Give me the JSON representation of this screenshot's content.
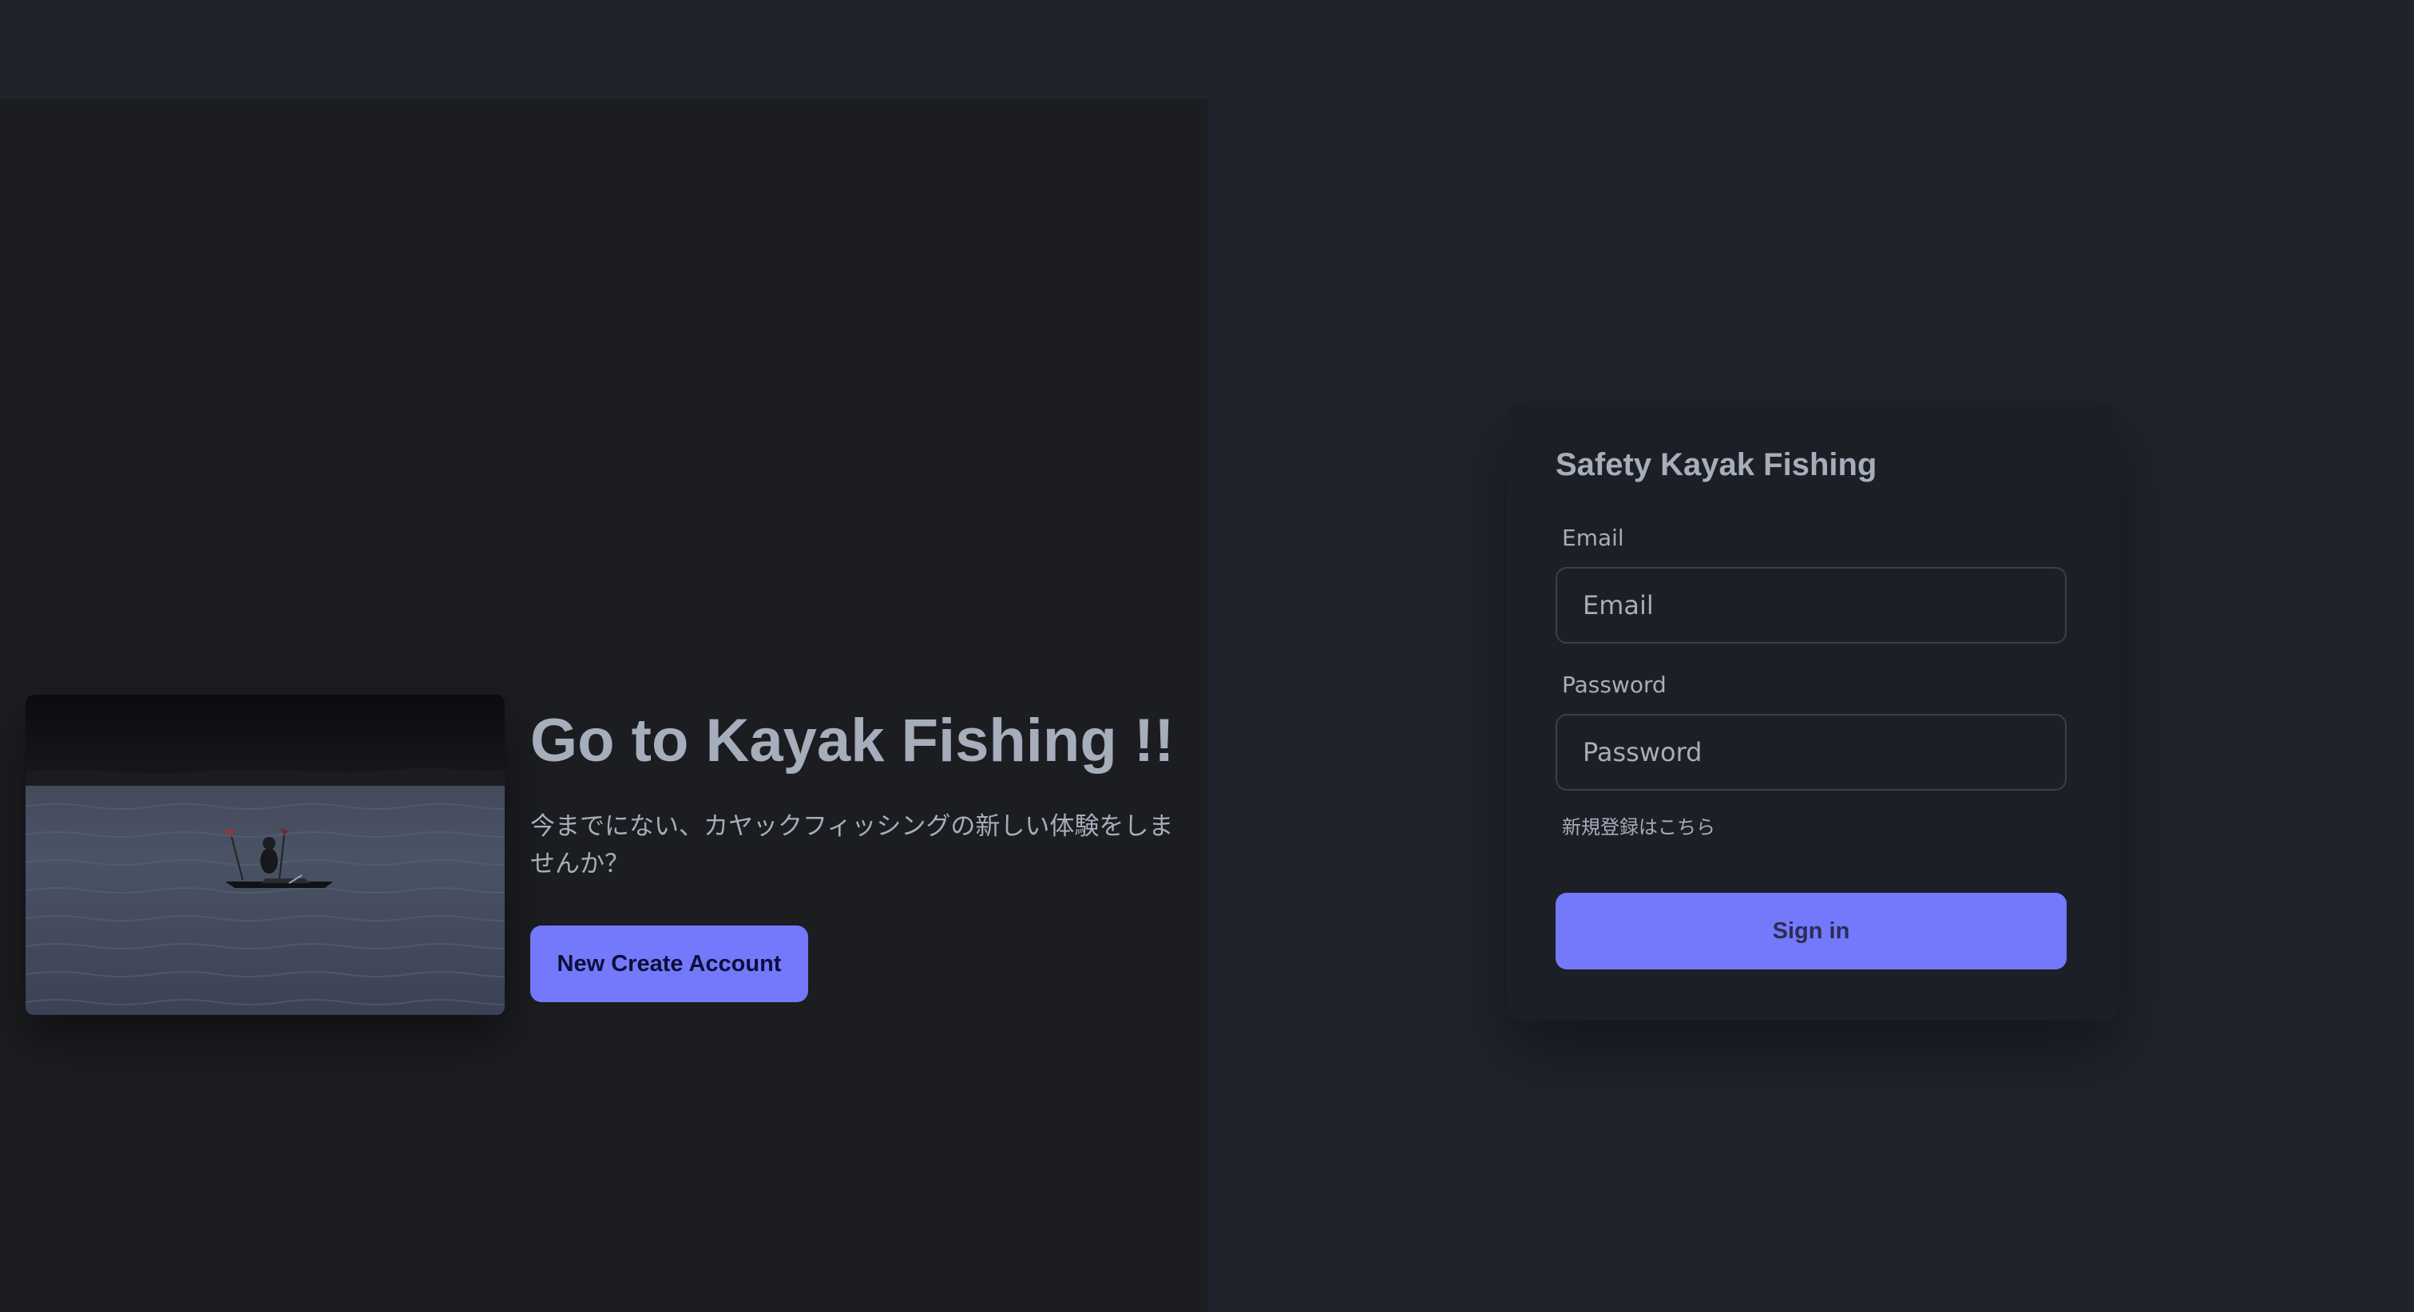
{
  "hero": {
    "title": "Go to Kayak Fishing !!",
    "description": "今までにない、カヤックフィッシングの新しい体験をしませんか？",
    "create_account_label": "New Create Account"
  },
  "login": {
    "title": "Safety Kayak Fishing",
    "email_label": "Email",
    "email_placeholder": "Email",
    "email_value": "",
    "password_label": "Password",
    "password_placeholder": "Password",
    "password_value": "",
    "register_link": "新規登録はこちら",
    "signin_label": "Sign in"
  },
  "colors": {
    "page_background": "#1f232b",
    "hero_background": "#1b1d21",
    "card_background": "#1c1f25",
    "primary": "#7479fb",
    "text": "#a6adbb"
  }
}
